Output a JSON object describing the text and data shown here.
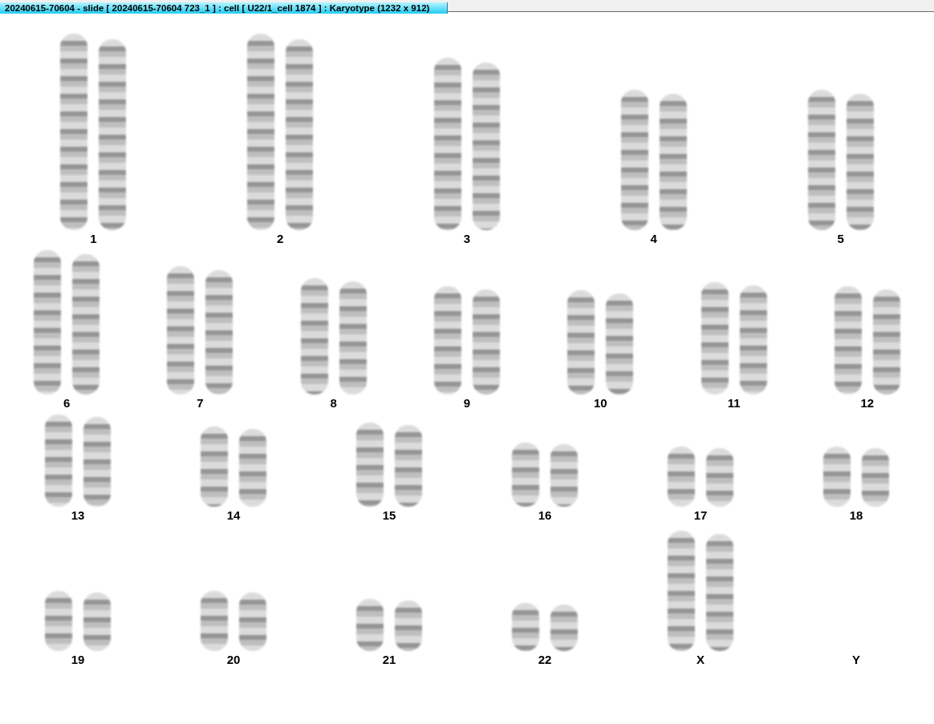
{
  "window": {
    "title": "20240615-70604 - slide [ 20240615-70604 723_1 ] : cell [ U22/1_cell 1874 ] : Karyotype  (1232 x 912)"
  },
  "karyotype": {
    "rows": [
      {
        "pairs": [
          {
            "label": "1",
            "kind": "pair"
          },
          {
            "label": "2",
            "kind": "pair"
          },
          {
            "label": "3",
            "kind": "pair"
          },
          {
            "label": "4",
            "kind": "pair"
          },
          {
            "label": "5",
            "kind": "pair"
          }
        ]
      },
      {
        "pairs": [
          {
            "label": "6",
            "kind": "pair"
          },
          {
            "label": "7",
            "kind": "pair"
          },
          {
            "label": "8",
            "kind": "pair"
          },
          {
            "label": "9",
            "kind": "pair"
          },
          {
            "label": "10",
            "kind": "pair"
          },
          {
            "label": "11",
            "kind": "pair"
          },
          {
            "label": "12",
            "kind": "pair"
          }
        ]
      },
      {
        "pairs": [
          {
            "label": "13",
            "kind": "pair"
          },
          {
            "label": "14",
            "kind": "pair"
          },
          {
            "label": "15",
            "kind": "pair"
          },
          {
            "label": "16",
            "kind": "pair"
          },
          {
            "label": "17",
            "kind": "pair"
          },
          {
            "label": "18",
            "kind": "pair"
          }
        ]
      },
      {
        "pairs": [
          {
            "label": "19",
            "kind": "pair"
          },
          {
            "label": "20",
            "kind": "pair"
          },
          {
            "label": "21",
            "kind": "pair"
          },
          {
            "label": "22",
            "kind": "pair"
          },
          {
            "label": "X",
            "kind": "pair"
          },
          {
            "label": "Y",
            "kind": "empty"
          }
        ]
      }
    ]
  }
}
